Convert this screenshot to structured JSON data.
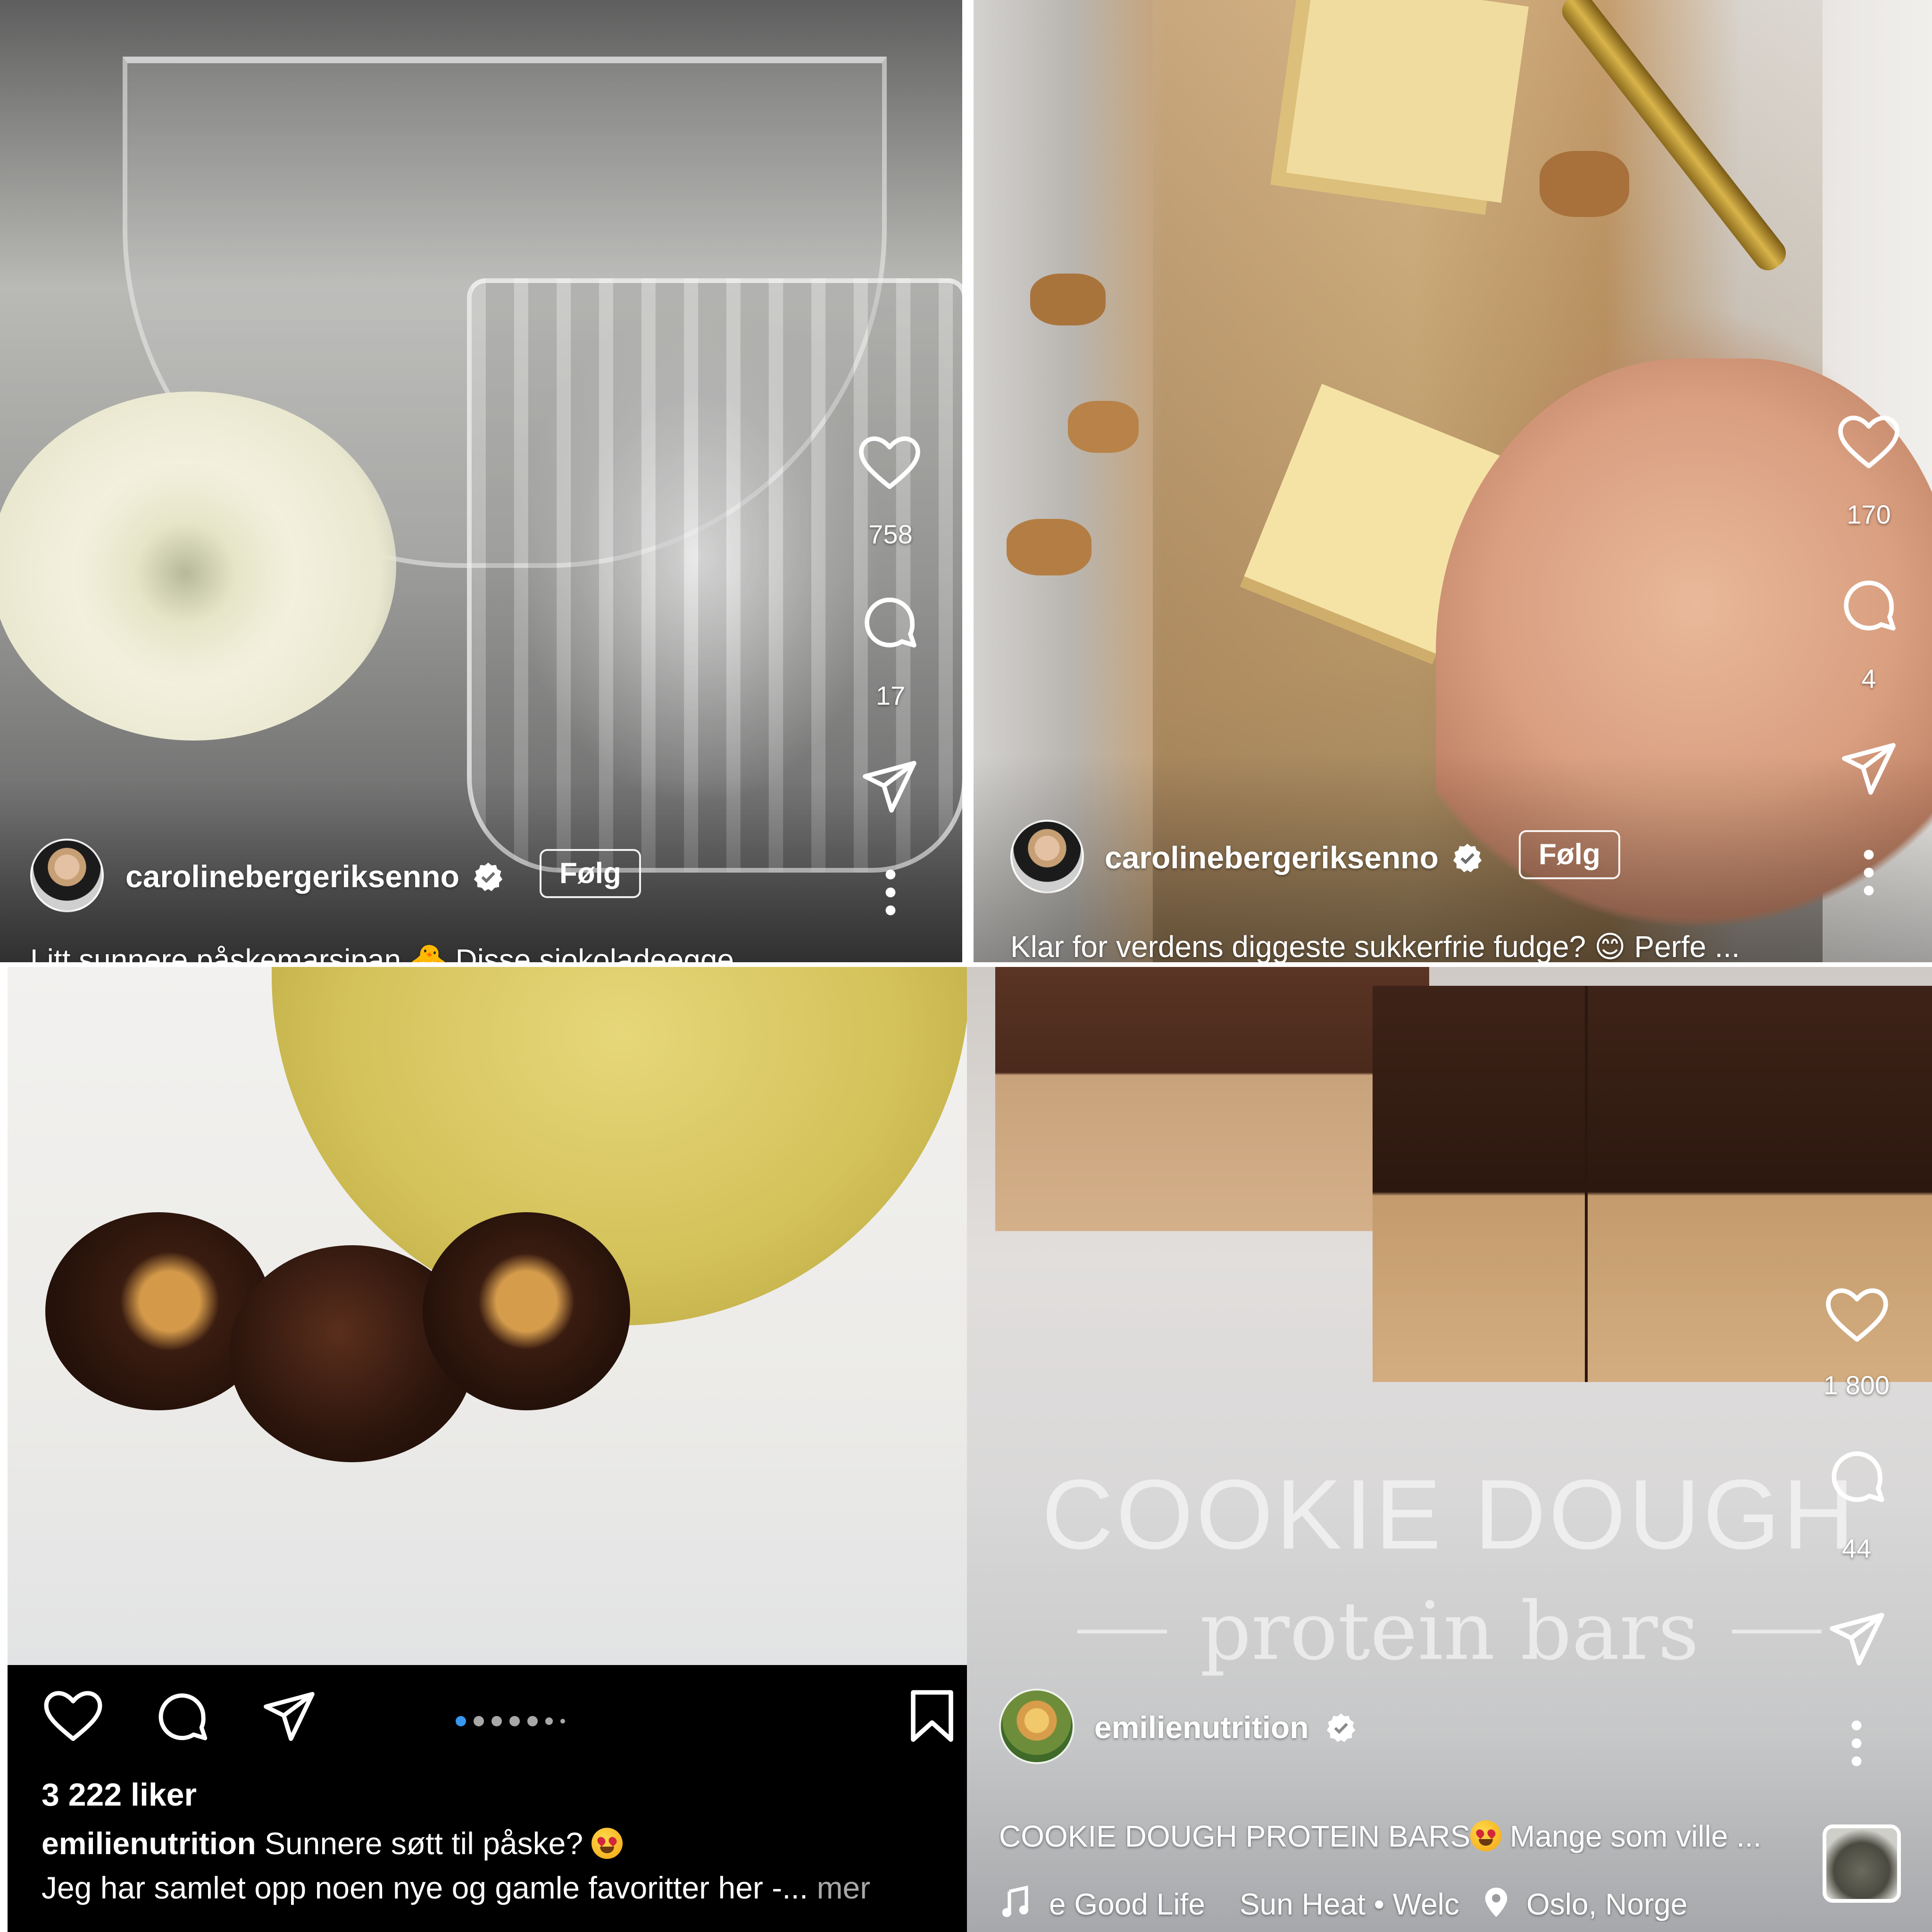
{
  "panels": {
    "top_left": {
      "likes": "758",
      "comments": "17",
      "username": "carolinebergeriksenno",
      "follow_label": "Følg",
      "caption_partial": "Litt sunnere påskemarsipan 🐣 Disse sjokoladeegge"
    },
    "top_right": {
      "likes": "170",
      "comments": "4",
      "username": "carolinebergeriksenno",
      "follow_label": "Følg",
      "caption": "Klar for verdens diggeste sukkerfrie fudge? 😊 Perfe ..."
    },
    "bottom_left": {
      "likes_count": "3 222 liker",
      "username": "emilienutrition",
      "caption_first": "Sunnere søtt til påske?",
      "caption_second": "Jeg har samlet opp noen nye og gamle favoritter her -...",
      "more_label": "mer",
      "carousel_dots": 7,
      "carousel_active": 0
    },
    "bottom_right": {
      "overlay_title": "COOKIE DOUGH",
      "overlay_subtitle": "protein bars",
      "likes": "1 800",
      "comments": "44",
      "username": "emilienutrition",
      "caption": "COOKIE DOUGH PROTEIN BARS",
      "caption_tail": " Mange som ville ...",
      "audio_text": "e Good Life",
      "audio_text_2": "Sun Heat • Welc",
      "location": "Oslo, Norge"
    }
  },
  "colors": {
    "verified_blue": "#ffffff",
    "active_dot": "#3897f0",
    "inactive_dot": "#a8a8a8",
    "post_background": "#000000"
  },
  "icons": [
    "heart-icon",
    "comment-icon",
    "share-icon",
    "more-icon",
    "bookmark-icon",
    "music-icon",
    "location-pin-icon",
    "verified-icon"
  ]
}
